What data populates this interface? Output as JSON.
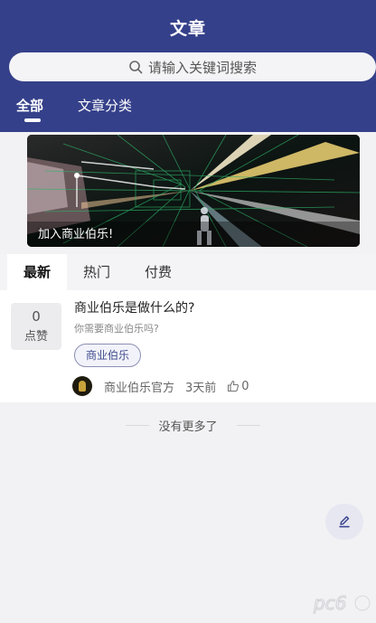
{
  "header": {
    "title": "文章",
    "search_placeholder": "请输入关键词搜索",
    "tabs": [
      "全部",
      "文章分类"
    ]
  },
  "banner": {
    "caption": "加入商业伯乐!"
  },
  "subtabs": [
    "最新",
    "热门",
    "付费"
  ],
  "article": {
    "likes_count": "0",
    "likes_label": "点赞",
    "title": "商业伯乐是做什么的?",
    "subtitle": "你需要商业伯乐吗?",
    "tag": "商业伯乐",
    "author": "商业伯乐官方",
    "time": "3天前",
    "thumb_count": "0"
  },
  "footer": {
    "no_more": "没有更多了"
  },
  "watermark": "pc6",
  "colors": {
    "header_bg": "#35408a",
    "tag_text": "#3e4a8c"
  },
  "icons": [
    "search-icon",
    "avatar",
    "thumb-up-icon",
    "edit-icon"
  ]
}
